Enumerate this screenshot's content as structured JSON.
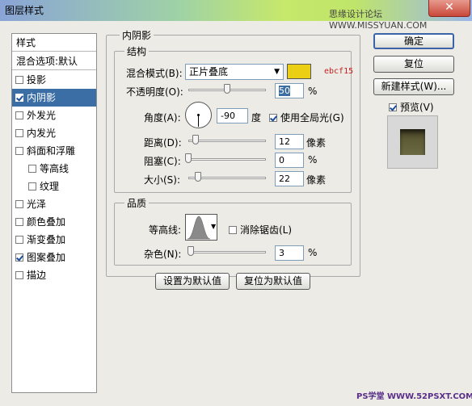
{
  "window": {
    "title": "图层样式",
    "watermark_top": "思缘设计论坛 WWW.MISSYUAN.COM",
    "close_label": "✕"
  },
  "sidebar": {
    "header": "样式",
    "blend_options": "混合选项:默认",
    "items": [
      {
        "label": "投影",
        "checked": false,
        "selected": false
      },
      {
        "label": "内阴影",
        "checked": true,
        "selected": true
      },
      {
        "label": "外发光",
        "checked": false,
        "selected": false
      },
      {
        "label": "内发光",
        "checked": false,
        "selected": false
      },
      {
        "label": "斜面和浮雕",
        "checked": false,
        "selected": false
      },
      {
        "label": "等高线",
        "checked": false,
        "selected": false
      },
      {
        "label": "纹理",
        "checked": false,
        "selected": false
      },
      {
        "label": "光泽",
        "checked": false,
        "selected": false
      },
      {
        "label": "颜色叠加",
        "checked": false,
        "selected": false
      },
      {
        "label": "渐变叠加",
        "checked": false,
        "selected": false
      },
      {
        "label": "图案叠加",
        "checked": true,
        "selected": false
      },
      {
        "label": "描边",
        "checked": false,
        "selected": false
      }
    ]
  },
  "inner_shadow": {
    "title": "内阴影",
    "structure": {
      "title": "结构",
      "blend_mode_label": "混合模式(B):",
      "blend_mode_value": "正片叠底",
      "color": "#ebcf15",
      "color_note": "ebcf15",
      "opacity_label": "不透明度(O):",
      "opacity_value": "50",
      "opacity_fraction": 0.5,
      "percent": "%",
      "angle_label": "角度(A):",
      "angle_value": "-90",
      "angle_unit": "度",
      "global_light_label": "使用全局光(G)",
      "global_light_checked": true,
      "distance_label": "距离(D):",
      "distance_value": "12",
      "choke_label": "阻塞(C):",
      "choke_value": "0",
      "size_label": "大小(S):",
      "size_value": "22",
      "px_unit": "像素"
    },
    "quality": {
      "title": "品质",
      "contour_label": "等高线:",
      "antialias_label": "消除锯齿(L)",
      "antialias_checked": false,
      "noise_label": "杂色(N):",
      "noise_value": "3"
    },
    "make_default": "设置为默认值",
    "reset_default": "复位为默认值"
  },
  "buttons": {
    "ok": "确定",
    "reset": "复位",
    "new_style": "新建样式(W)...",
    "preview_label": "预览(V)",
    "preview_checked": true
  },
  "watermark_bottom": "PS学堂 WWW.52PSXT.COM"
}
